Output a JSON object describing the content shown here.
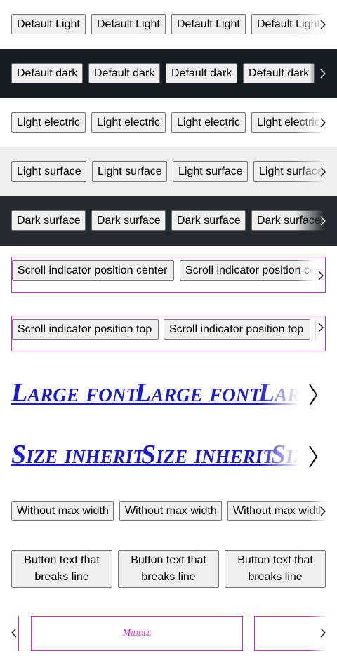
{
  "rows": {
    "default_light": {
      "label": "Default Light",
      "bg": "#ffffff"
    },
    "default_dark": {
      "label": "Default dark",
      "bg": "#161c22"
    },
    "light_electric": {
      "label": "Light electric",
      "bg": "#ffffff"
    },
    "light_surface": {
      "label": "Light surface",
      "bg": "#efefef"
    },
    "dark_surface": {
      "label": "Dark surface",
      "bg": "#262a2e"
    },
    "position_center": {
      "label": "Scroll indicator position center"
    },
    "position_top": {
      "label": "Scroll indicator position top"
    },
    "large_font": {
      "label": "Large font"
    },
    "size_inherit": {
      "label": "Size inherit"
    },
    "without_max_width": {
      "label": "Without max width"
    },
    "breaks_line": {
      "label": "Button text that breaks line"
    },
    "middle": {
      "label": "Middle"
    }
  },
  "colors": {
    "accent_border": "#e020c0",
    "link": "#1a1ad0"
  },
  "icons": {
    "next": "chevron-right-icon",
    "prev": "chevron-left-icon"
  }
}
